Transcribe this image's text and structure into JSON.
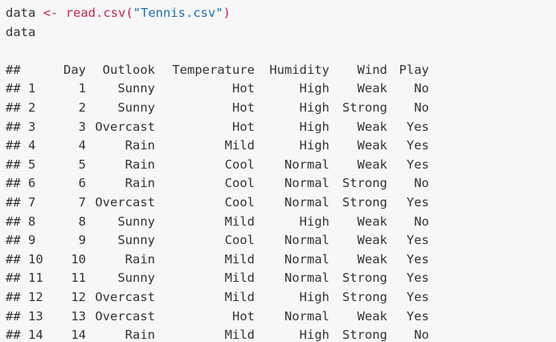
{
  "code": {
    "line1": {
      "var": "data",
      "op": "<-",
      "fn": "read.csv(",
      "arg": "\"Tennis.csv\"",
      "close": ")"
    },
    "line2": "data"
  },
  "output": {
    "header": {
      "prefix": "##",
      "columns": [
        "Day",
        "Outlook",
        "Temperature",
        "Humidity",
        "Wind",
        "Play"
      ]
    },
    "rows": [
      {
        "prefix": "## 1",
        "day": "1",
        "outlook": "Sunny",
        "temp": "Hot",
        "hum": "High",
        "wind": "Weak",
        "play": "No"
      },
      {
        "prefix": "## 2",
        "day": "2",
        "outlook": "Sunny",
        "temp": "Hot",
        "hum": "High",
        "wind": "Strong",
        "play": "No"
      },
      {
        "prefix": "## 3",
        "day": "3",
        "outlook": "Overcast",
        "temp": "Hot",
        "hum": "High",
        "wind": "Weak",
        "play": "Yes"
      },
      {
        "prefix": "## 4",
        "day": "4",
        "outlook": "Rain",
        "temp": "Mild",
        "hum": "High",
        "wind": "Weak",
        "play": "Yes"
      },
      {
        "prefix": "## 5",
        "day": "5",
        "outlook": "Rain",
        "temp": "Cool",
        "hum": "Normal",
        "wind": "Weak",
        "play": "Yes"
      },
      {
        "prefix": "## 6",
        "day": "6",
        "outlook": "Rain",
        "temp": "Cool",
        "hum": "Normal",
        "wind": "Strong",
        "play": "No"
      },
      {
        "prefix": "## 7",
        "day": "7",
        "outlook": "Overcast",
        "temp": "Cool",
        "hum": "Normal",
        "wind": "Strong",
        "play": "Yes"
      },
      {
        "prefix": "## 8",
        "day": "8",
        "outlook": "Sunny",
        "temp": "Mild",
        "hum": "High",
        "wind": "Weak",
        "play": "No"
      },
      {
        "prefix": "## 9",
        "day": "9",
        "outlook": "Sunny",
        "temp": "Cool",
        "hum": "Normal",
        "wind": "Weak",
        "play": "Yes"
      },
      {
        "prefix": "## 10",
        "day": "10",
        "outlook": "Rain",
        "temp": "Mild",
        "hum": "Normal",
        "wind": "Weak",
        "play": "Yes"
      },
      {
        "prefix": "## 11",
        "day": "11",
        "outlook": "Sunny",
        "temp": "Mild",
        "hum": "Normal",
        "wind": "Strong",
        "play": "Yes"
      },
      {
        "prefix": "## 12",
        "day": "12",
        "outlook": "Overcast",
        "temp": "Mild",
        "hum": "High",
        "wind": "Strong",
        "play": "Yes"
      },
      {
        "prefix": "## 13",
        "day": "13",
        "outlook": "Overcast",
        "temp": "Hot",
        "hum": "Normal",
        "wind": "Weak",
        "play": "Yes"
      },
      {
        "prefix": "## 14",
        "day": "14",
        "outlook": "Rain",
        "temp": "Mild",
        "hum": "High",
        "wind": "Strong",
        "play": "No"
      }
    ]
  },
  "colors": {
    "background": "#f7f7f7",
    "text": "#333333",
    "operator": "#c7254e",
    "string": "#1a6fb0"
  }
}
